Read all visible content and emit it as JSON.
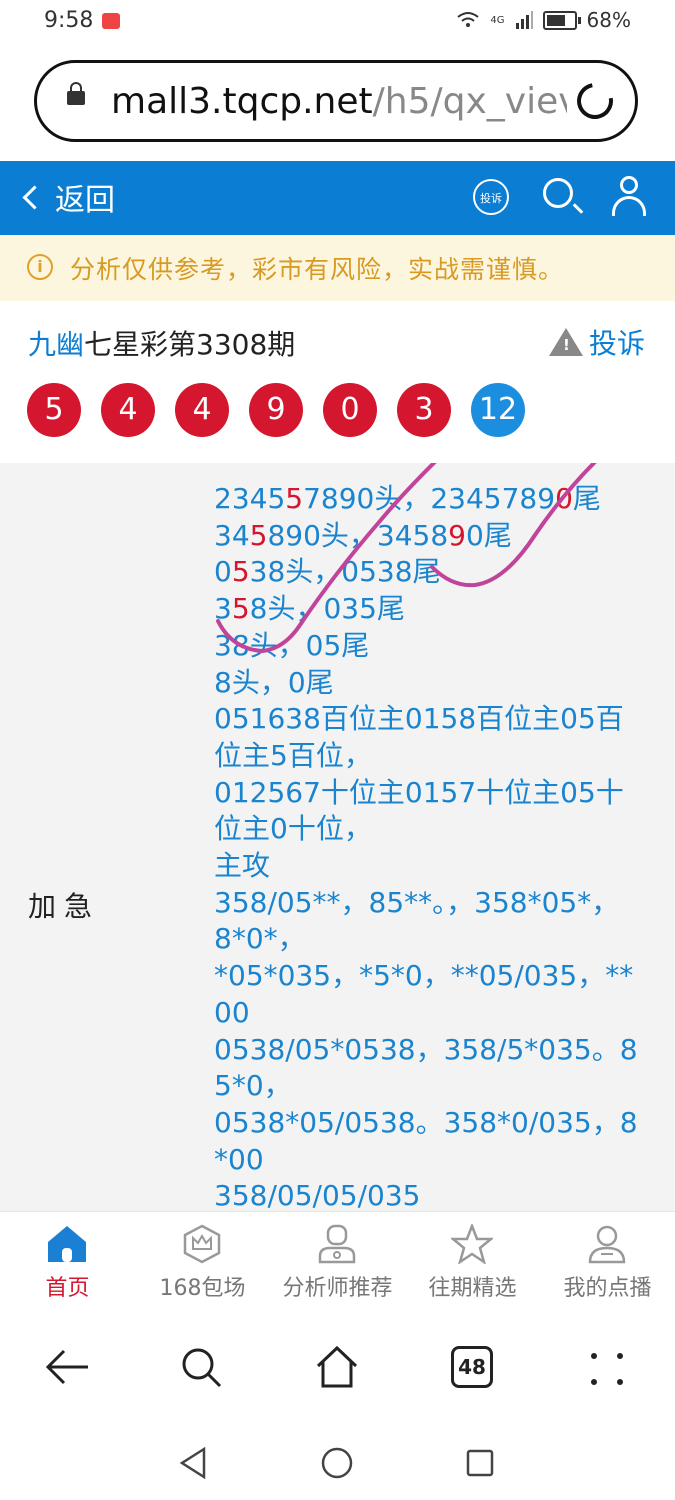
{
  "status": {
    "time": "9:58",
    "network": "4G",
    "battery": "68%"
  },
  "browser": {
    "url_host": "mall3.tqcp.net",
    "url_path": "/h5/qx_viev",
    "tab_count": "48"
  },
  "nav": {
    "back_label": "返回",
    "complain_badge": "投诉"
  },
  "notice": {
    "text": "分析仅供参考，彩市有风险，实战需谨慎。"
  },
  "article": {
    "author": "九幽",
    "title_rest": "七星彩第3308期",
    "report_label": "投诉",
    "balls": [
      {
        "value": "5",
        "color": "red"
      },
      {
        "value": "4",
        "color": "red"
      },
      {
        "value": "4",
        "color": "red"
      },
      {
        "value": "9",
        "color": "red"
      },
      {
        "value": "0",
        "color": "red"
      },
      {
        "value": "3",
        "color": "red"
      },
      {
        "value": "12",
        "color": "blue"
      }
    ],
    "section_label": "加急",
    "lines": [
      [
        [
          "2345",
          ""
        ],
        [
          "5",
          "hl"
        ],
        [
          "7890头，2345789",
          ""
        ],
        [
          "0",
          "hl"
        ],
        [
          "尾",
          ""
        ]
      ],
      [
        [
          "34",
          ""
        ],
        [
          "5",
          "hl"
        ],
        [
          "890头，3458",
          ""
        ],
        [
          "9",
          "hl"
        ],
        [
          "0尾",
          ""
        ]
      ],
      [
        [
          "0",
          ""
        ],
        [
          "5",
          "hl"
        ],
        [
          "38头，0538尾",
          ""
        ]
      ],
      [
        [
          "3",
          ""
        ],
        [
          "5",
          "hl"
        ],
        [
          "8头，035尾",
          ""
        ]
      ],
      [
        [
          "38头，05尾",
          ""
        ]
      ],
      [
        [
          "8头，0尾",
          ""
        ]
      ],
      [
        [
          "051638百位主0158百位主05百",
          ""
        ]
      ],
      [
        [
          "位主5百位，",
          ""
        ]
      ],
      [
        [
          "012567十位主0157十位主05十",
          ""
        ]
      ],
      [
        [
          "位主0十位，",
          ""
        ]
      ],
      [
        [
          "主攻",
          ""
        ]
      ],
      [
        [
          "358/05**，85**。，358*05*，",
          ""
        ]
      ],
      [
        [
          "8*0*，",
          ""
        ]
      ],
      [
        [
          "*05*035，*5*0，**05/035，**",
          ""
        ]
      ],
      [
        [
          "00",
          ""
        ]
      ],
      [
        [
          "0538/05*0538，358/5*035。8",
          ""
        ]
      ],
      [
        [
          "5*0，",
          ""
        ]
      ],
      [
        [
          "0538*05/0538。358*0/035，8",
          ""
        ]
      ],
      [
        [
          "*00",
          ""
        ]
      ],
      [
        [
          "358/05/05/035",
          ""
        ]
      ]
    ]
  },
  "tabs": [
    {
      "label": "首页",
      "icon": "home-icon",
      "active": true
    },
    {
      "label": "168包场",
      "icon": "crown-badge-icon",
      "active": false
    },
    {
      "label": "分析师推荐",
      "icon": "analyst-icon",
      "active": false
    },
    {
      "label": "往期精选",
      "icon": "star-icon",
      "active": false
    },
    {
      "label": "我的点播",
      "icon": "profile-icon",
      "active": false
    }
  ],
  "colors": {
    "primary": "#0b7ed4",
    "red": "#d5162f",
    "blue_ball": "#1b8ee0",
    "notice_text": "#d89a23",
    "notice_bg": "#fdf6de",
    "scribble": "#c0449a"
  }
}
